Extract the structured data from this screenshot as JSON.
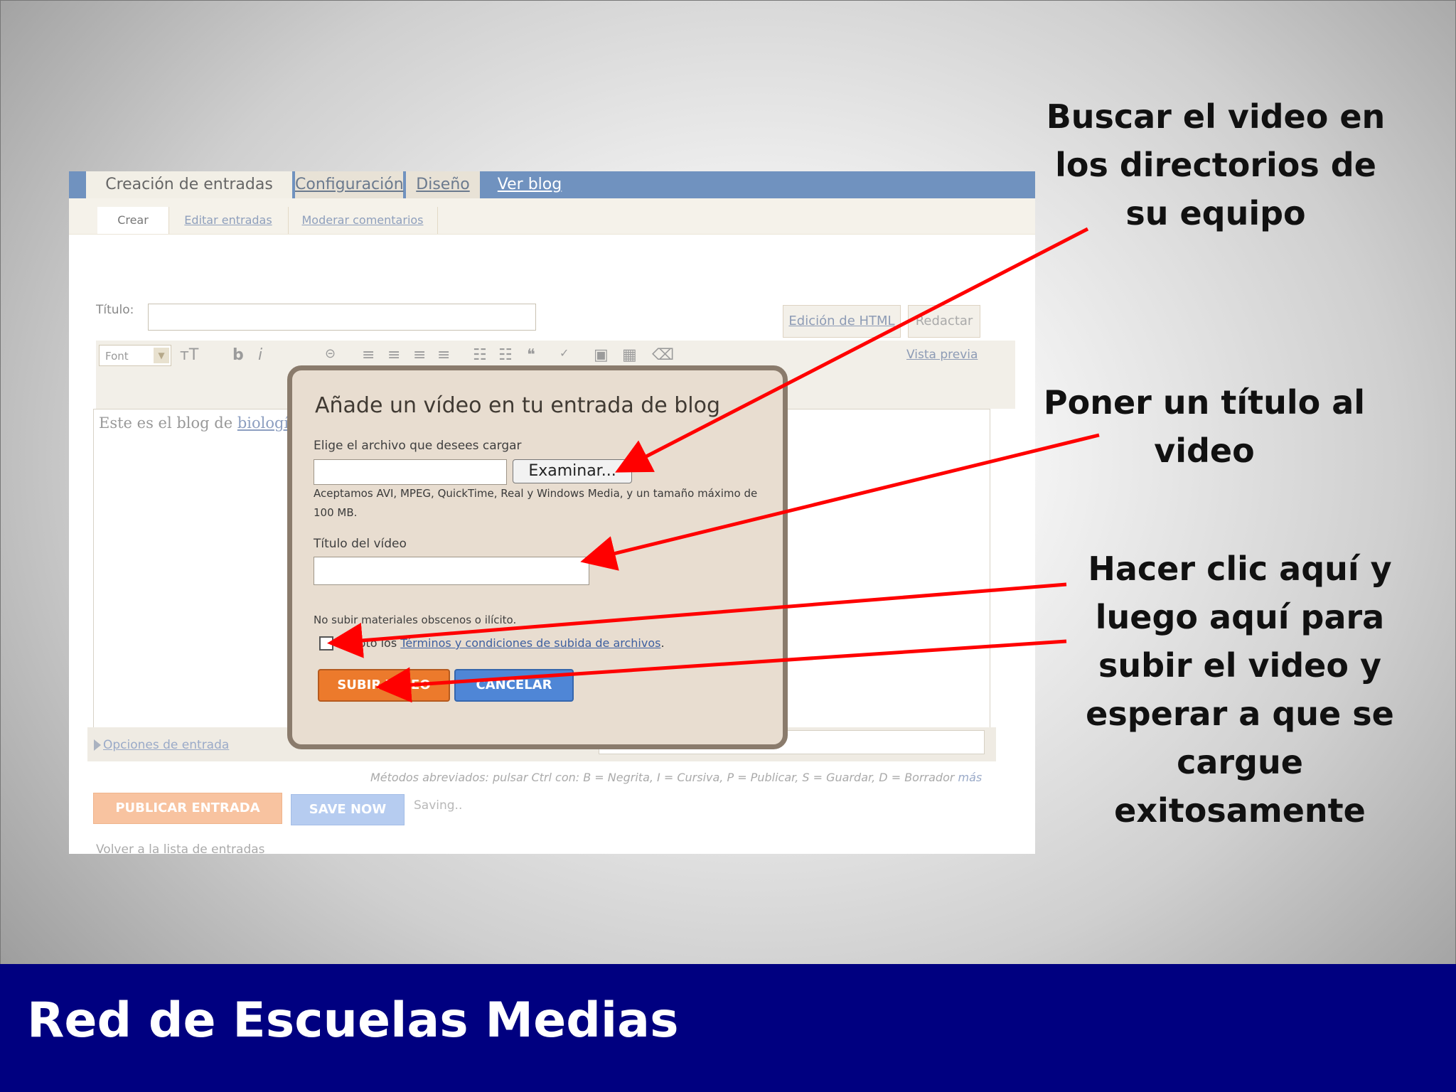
{
  "tabs": {
    "creacion": "Creación de entradas",
    "configuracion": "Configuración",
    "diseno": "Diseño",
    "ver_blog": "Ver blog"
  },
  "subtabs": {
    "crear": "Crear",
    "editar": "Editar entradas",
    "moderar": "Moderar comentarios"
  },
  "editor": {
    "titulo_label": "Título:",
    "html_mode": "Edición de HTML",
    "redactar_mode": "Redactar",
    "font_select": "Font",
    "vista_previa": "Vista previa",
    "body_text": "Este es el blog de ",
    "body_link": "biología",
    "opciones": "Opciones de entrada",
    "hint_prefix": "Métodos abreviados: pulsar ",
    "hint_body": "Ctrl con: B = Negrita, I = Cursiva, P = Publicar, S = Guardar, D = Borrador ",
    "hint_more": "más",
    "publicar": "PUBLICAR ENTRADA",
    "save_now": "SAVE NOW",
    "saving": "Saving..",
    "volver": "Volver a la lista de entradas"
  },
  "dialog": {
    "title": "Añade un vídeo en tu entrada de blog",
    "file_label": "Elige el archivo que desees cargar",
    "browse": "Examinar...",
    "accepted": "Aceptamos AVI, MPEG, QuickTime, Real y Windows Media, y un tamaño máximo de 100 MB.",
    "video_title_label": "Título del vídeo",
    "warning": "No subir materiales obscenos o ilícito.",
    "accept_prefix": "Acepto los ",
    "accept_link": "Términos y condiciones de subida de archivos",
    "accept_suffix": ".",
    "subir": "SUBIR VÍDEO",
    "cancelar": "CANCELAR"
  },
  "callouts": {
    "buscar": [
      "Buscar el video en",
      "los directorios de",
      "su equipo"
    ],
    "titulo": [
      "Poner un título al",
      "video"
    ],
    "clic": [
      "Hacer clic aquí y",
      "luego aquí para",
      "subir el video y",
      "esperar a que se",
      "cargue",
      "exitosamente"
    ]
  },
  "footer": "Red de Escuelas Medias",
  "colors": {
    "footer_bg": "#000080",
    "arrow": "#ff0000",
    "tabbar": "#7092bf",
    "subir_btn": "#ec7a2c",
    "cancel_btn": "#4f86d6"
  }
}
